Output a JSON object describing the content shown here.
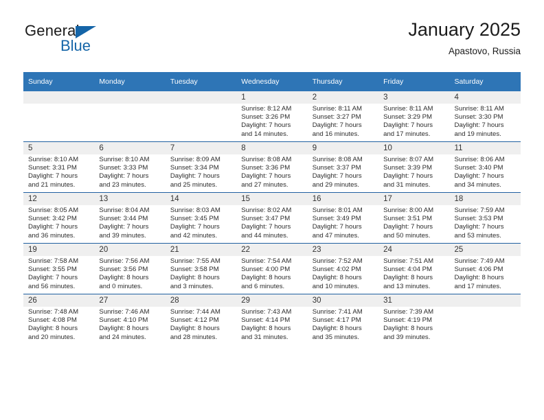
{
  "brand": {
    "name_top": "General",
    "name_bottom": "Blue",
    "accent_color": "#1565a8",
    "triangle_icon": "triangle-icon"
  },
  "header": {
    "title": "January 2025",
    "subtitle": "Apastovo, Russia"
  },
  "calendar": {
    "header_bg": "#2e75b6",
    "row_divider_color": "#1f5fa0",
    "daynum_band_color": "#efefef",
    "weekday_headers": [
      "Sunday",
      "Monday",
      "Tuesday",
      "Wednesday",
      "Thursday",
      "Friday",
      "Saturday"
    ],
    "weeks": [
      [
        {
          "day": "",
          "empty": true
        },
        {
          "day": "",
          "empty": true
        },
        {
          "day": "",
          "empty": true
        },
        {
          "day": "1",
          "sunrise": "Sunrise: 8:12 AM",
          "sunset": "Sunset: 3:26 PM",
          "daylight_1": "Daylight: 7 hours",
          "daylight_2": "and 14 minutes."
        },
        {
          "day": "2",
          "sunrise": "Sunrise: 8:11 AM",
          "sunset": "Sunset: 3:27 PM",
          "daylight_1": "Daylight: 7 hours",
          "daylight_2": "and 16 minutes."
        },
        {
          "day": "3",
          "sunrise": "Sunrise: 8:11 AM",
          "sunset": "Sunset: 3:29 PM",
          "daylight_1": "Daylight: 7 hours",
          "daylight_2": "and 17 minutes."
        },
        {
          "day": "4",
          "sunrise": "Sunrise: 8:11 AM",
          "sunset": "Sunset: 3:30 PM",
          "daylight_1": "Daylight: 7 hours",
          "daylight_2": "and 19 minutes."
        }
      ],
      [
        {
          "day": "5",
          "sunrise": "Sunrise: 8:10 AM",
          "sunset": "Sunset: 3:31 PM",
          "daylight_1": "Daylight: 7 hours",
          "daylight_2": "and 21 minutes."
        },
        {
          "day": "6",
          "sunrise": "Sunrise: 8:10 AM",
          "sunset": "Sunset: 3:33 PM",
          "daylight_1": "Daylight: 7 hours",
          "daylight_2": "and 23 minutes."
        },
        {
          "day": "7",
          "sunrise": "Sunrise: 8:09 AM",
          "sunset": "Sunset: 3:34 PM",
          "daylight_1": "Daylight: 7 hours",
          "daylight_2": "and 25 minutes."
        },
        {
          "day": "8",
          "sunrise": "Sunrise: 8:08 AM",
          "sunset": "Sunset: 3:36 PM",
          "daylight_1": "Daylight: 7 hours",
          "daylight_2": "and 27 minutes."
        },
        {
          "day": "9",
          "sunrise": "Sunrise: 8:08 AM",
          "sunset": "Sunset: 3:37 PM",
          "daylight_1": "Daylight: 7 hours",
          "daylight_2": "and 29 minutes."
        },
        {
          "day": "10",
          "sunrise": "Sunrise: 8:07 AM",
          "sunset": "Sunset: 3:39 PM",
          "daylight_1": "Daylight: 7 hours",
          "daylight_2": "and 31 minutes."
        },
        {
          "day": "11",
          "sunrise": "Sunrise: 8:06 AM",
          "sunset": "Sunset: 3:40 PM",
          "daylight_1": "Daylight: 7 hours",
          "daylight_2": "and 34 minutes."
        }
      ],
      [
        {
          "day": "12",
          "sunrise": "Sunrise: 8:05 AM",
          "sunset": "Sunset: 3:42 PM",
          "daylight_1": "Daylight: 7 hours",
          "daylight_2": "and 36 minutes."
        },
        {
          "day": "13",
          "sunrise": "Sunrise: 8:04 AM",
          "sunset": "Sunset: 3:44 PM",
          "daylight_1": "Daylight: 7 hours",
          "daylight_2": "and 39 minutes."
        },
        {
          "day": "14",
          "sunrise": "Sunrise: 8:03 AM",
          "sunset": "Sunset: 3:45 PM",
          "daylight_1": "Daylight: 7 hours",
          "daylight_2": "and 42 minutes."
        },
        {
          "day": "15",
          "sunrise": "Sunrise: 8:02 AM",
          "sunset": "Sunset: 3:47 PM",
          "daylight_1": "Daylight: 7 hours",
          "daylight_2": "and 44 minutes."
        },
        {
          "day": "16",
          "sunrise": "Sunrise: 8:01 AM",
          "sunset": "Sunset: 3:49 PM",
          "daylight_1": "Daylight: 7 hours",
          "daylight_2": "and 47 minutes."
        },
        {
          "day": "17",
          "sunrise": "Sunrise: 8:00 AM",
          "sunset": "Sunset: 3:51 PM",
          "daylight_1": "Daylight: 7 hours",
          "daylight_2": "and 50 minutes."
        },
        {
          "day": "18",
          "sunrise": "Sunrise: 7:59 AM",
          "sunset": "Sunset: 3:53 PM",
          "daylight_1": "Daylight: 7 hours",
          "daylight_2": "and 53 minutes."
        }
      ],
      [
        {
          "day": "19",
          "sunrise": "Sunrise: 7:58 AM",
          "sunset": "Sunset: 3:55 PM",
          "daylight_1": "Daylight: 7 hours",
          "daylight_2": "and 56 minutes."
        },
        {
          "day": "20",
          "sunrise": "Sunrise: 7:56 AM",
          "sunset": "Sunset: 3:56 PM",
          "daylight_1": "Daylight: 8 hours",
          "daylight_2": "and 0 minutes."
        },
        {
          "day": "21",
          "sunrise": "Sunrise: 7:55 AM",
          "sunset": "Sunset: 3:58 PM",
          "daylight_1": "Daylight: 8 hours",
          "daylight_2": "and 3 minutes."
        },
        {
          "day": "22",
          "sunrise": "Sunrise: 7:54 AM",
          "sunset": "Sunset: 4:00 PM",
          "daylight_1": "Daylight: 8 hours",
          "daylight_2": "and 6 minutes."
        },
        {
          "day": "23",
          "sunrise": "Sunrise: 7:52 AM",
          "sunset": "Sunset: 4:02 PM",
          "daylight_1": "Daylight: 8 hours",
          "daylight_2": "and 10 minutes."
        },
        {
          "day": "24",
          "sunrise": "Sunrise: 7:51 AM",
          "sunset": "Sunset: 4:04 PM",
          "daylight_1": "Daylight: 8 hours",
          "daylight_2": "and 13 minutes."
        },
        {
          "day": "25",
          "sunrise": "Sunrise: 7:49 AM",
          "sunset": "Sunset: 4:06 PM",
          "daylight_1": "Daylight: 8 hours",
          "daylight_2": "and 17 minutes."
        }
      ],
      [
        {
          "day": "26",
          "sunrise": "Sunrise: 7:48 AM",
          "sunset": "Sunset: 4:08 PM",
          "daylight_1": "Daylight: 8 hours",
          "daylight_2": "and 20 minutes."
        },
        {
          "day": "27",
          "sunrise": "Sunrise: 7:46 AM",
          "sunset": "Sunset: 4:10 PM",
          "daylight_1": "Daylight: 8 hours",
          "daylight_2": "and 24 minutes."
        },
        {
          "day": "28",
          "sunrise": "Sunrise: 7:44 AM",
          "sunset": "Sunset: 4:12 PM",
          "daylight_1": "Daylight: 8 hours",
          "daylight_2": "and 28 minutes."
        },
        {
          "day": "29",
          "sunrise": "Sunrise: 7:43 AM",
          "sunset": "Sunset: 4:14 PM",
          "daylight_1": "Daylight: 8 hours",
          "daylight_2": "and 31 minutes."
        },
        {
          "day": "30",
          "sunrise": "Sunrise: 7:41 AM",
          "sunset": "Sunset: 4:17 PM",
          "daylight_1": "Daylight: 8 hours",
          "daylight_2": "and 35 minutes."
        },
        {
          "day": "31",
          "sunrise": "Sunrise: 7:39 AM",
          "sunset": "Sunset: 4:19 PM",
          "daylight_1": "Daylight: 8 hours",
          "daylight_2": "and 39 minutes."
        },
        {
          "day": "",
          "empty": true
        }
      ]
    ]
  }
}
